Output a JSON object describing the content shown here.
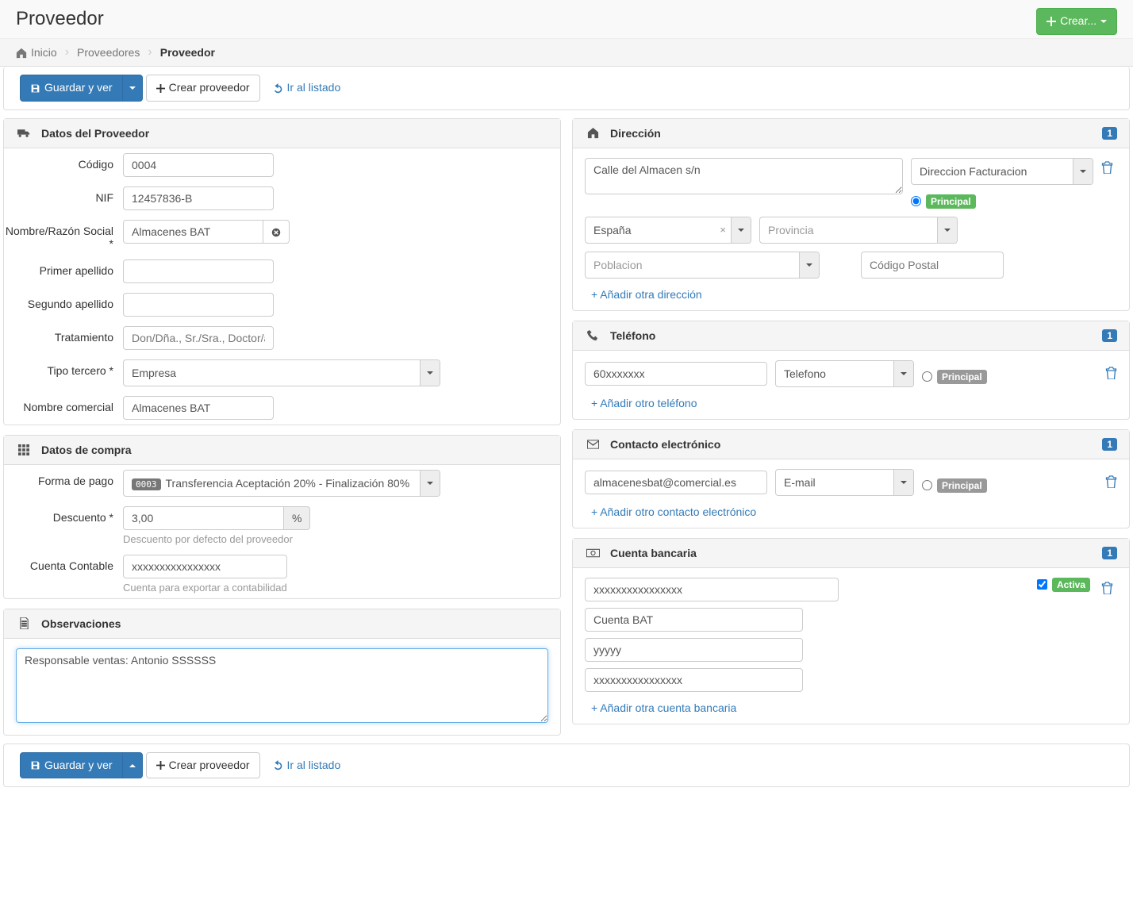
{
  "page_title": "Proveedor",
  "top_button": "Crear...",
  "breadcrumb": {
    "home": "Inicio",
    "list": "Proveedores",
    "current": "Proveedor"
  },
  "toolbar": {
    "save_label": "Guardar y ver",
    "create_label": "Crear proveedor",
    "back_label": "Ir al listado"
  },
  "panels": {
    "supplier": {
      "title": "Datos del Proveedor",
      "fields": {
        "codigo_label": "Código",
        "codigo_value": "0004",
        "nif_label": "NIF",
        "nif_value": "12457836-B",
        "nombre_label": "Nombre/Razón Social *",
        "nombre_value": "Almacenes BAT",
        "apellido1_label": "Primer apellido",
        "apellido1_value": "",
        "apellido2_label": "Segundo apellido",
        "apellido2_value": "",
        "tratamiento_label": "Tratamiento",
        "tratamiento_placeholder": "Don/Dña., Sr./Sra., Doctor/a ...",
        "tratamiento_value": "",
        "tipo_label": "Tipo tercero *",
        "tipo_value": "Empresa",
        "comercial_label": "Nombre comercial",
        "comercial_value": "Almacenes BAT"
      }
    },
    "compra": {
      "title": "Datos de compra",
      "fields": {
        "forma_label": "Forma de pago",
        "forma_code": "0003",
        "forma_value": "Transferencia Aceptación 20% - Finalización 80%",
        "descuento_label": "Descuento *",
        "descuento_value": "3,00",
        "descuento_help": "Descuento por defecto del proveedor",
        "descuento_unit": "%",
        "cuenta_label": "Cuenta Contable",
        "cuenta_value": "xxxxxxxxxxxxxxxx",
        "cuenta_help": "Cuenta para exportar a contabilidad"
      }
    },
    "obs": {
      "title": "Observaciones",
      "value": "Responsable ventas: Antonio SSSSSS"
    },
    "direccion": {
      "title": "Dirección",
      "count": "1",
      "address": "Calle del Almacen s/n",
      "tipo": "Direccion Facturacion",
      "principal": "Principal",
      "pais": "España",
      "provincia_placeholder": "Provincia",
      "poblacion_placeholder": "Poblacion",
      "cp_placeholder": "Código Postal",
      "add_link": "+ Añadir otra dirección"
    },
    "telefono": {
      "title": "Teléfono",
      "count": "1",
      "value": "60xxxxxxx",
      "tipo": "Telefono",
      "principal": "Principal",
      "add_link": "+ Añadir otro teléfono"
    },
    "contacto": {
      "title": "Contacto electrónico",
      "count": "1",
      "value": "almacenesbat@comercial.es",
      "tipo": "E-mail",
      "principal": "Principal",
      "add_link": "+ Añadir otro contacto electrónico"
    },
    "banco": {
      "title": "Cuenta bancaria",
      "count": "1",
      "num": "xxxxxxxxxxxxxxxx",
      "nombre": "Cuenta BAT",
      "swift": "yyyyy",
      "otro": "xxxxxxxxxxxxxxxx",
      "activa": "Activa",
      "add_link": "+ Añadir otra cuenta bancaria"
    }
  }
}
